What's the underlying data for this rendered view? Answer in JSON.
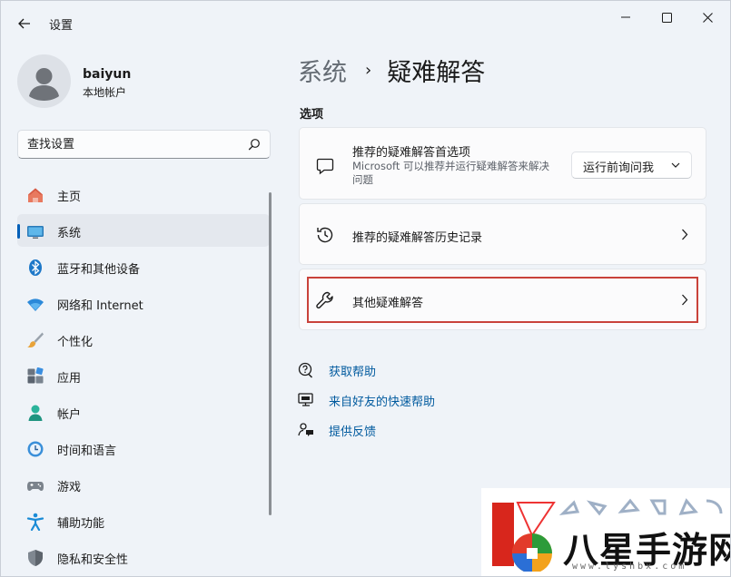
{
  "window": {
    "app_title": "设置",
    "controls": {
      "minimize": "minimize-icon",
      "maximize": "maximize-icon",
      "close": "close-icon"
    }
  },
  "profile": {
    "name": "baiyun",
    "account_type": "本地帐户"
  },
  "search": {
    "placeholder": "查找设置"
  },
  "nav": {
    "items": [
      {
        "label": "主页",
        "icon": "home-icon"
      },
      {
        "label": "系统",
        "icon": "system-icon",
        "active": true
      },
      {
        "label": "蓝牙和其他设备",
        "icon": "bluetooth-icon"
      },
      {
        "label": "网络和 Internet",
        "icon": "wifi-icon"
      },
      {
        "label": "个性化",
        "icon": "brush-icon"
      },
      {
        "label": "应用",
        "icon": "apps-icon"
      },
      {
        "label": "帐户",
        "icon": "account-icon"
      },
      {
        "label": "时间和语言",
        "icon": "time-language-icon"
      },
      {
        "label": "游戏",
        "icon": "gamepad-icon"
      },
      {
        "label": "辅助功能",
        "icon": "accessibility-icon"
      },
      {
        "label": "隐私和安全性",
        "icon": "shield-icon"
      }
    ]
  },
  "breadcrumb": {
    "parent": "系统",
    "separator": "›",
    "current": "疑难解答"
  },
  "options": {
    "section_title": "选项",
    "recommended_prefs": {
      "title": "推荐的疑难解答首选项",
      "description": "Microsoft 可以推荐并运行疑难解答来解决问题",
      "dropdown_value": "运行前询问我"
    },
    "history": {
      "title": "推荐的疑难解答历史记录"
    },
    "other": {
      "title": "其他疑难解答"
    }
  },
  "help_links": [
    {
      "label": "获取帮助",
      "icon": "help-icon"
    },
    {
      "label": "来自好友的快速帮助",
      "icon": "quick-assist-icon"
    },
    {
      "label": "提供反馈",
      "icon": "feedback-icon"
    }
  ],
  "watermark": {
    "text": "八星手游网",
    "url": "www.lyshbx.com"
  },
  "colors": {
    "accent": "#005fb8",
    "link": "#005a9e",
    "highlight": "#c9423a",
    "background": "#eff3f8"
  }
}
